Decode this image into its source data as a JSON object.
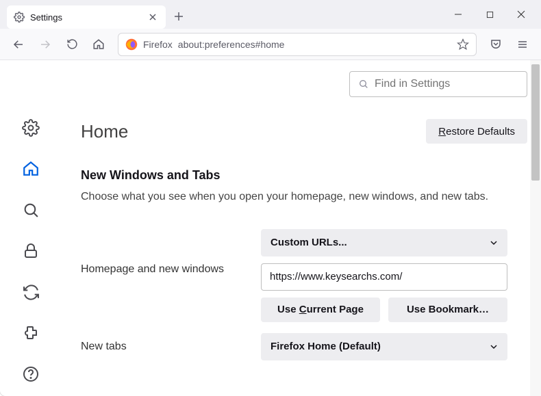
{
  "tab": {
    "title": "Settings"
  },
  "urlbar": {
    "browser_label": "Firefox",
    "url": "about:preferences#home"
  },
  "search": {
    "placeholder": "Find in Settings"
  },
  "page": {
    "title": "Home",
    "restore_btn": "Restore Defaults",
    "section_title": "New Windows and Tabs",
    "section_desc": "Choose what you see when you open your homepage, new windows, and new tabs."
  },
  "homepage": {
    "label": "Homepage and new windows",
    "select_value": "Custom URLs...",
    "url_value": "https://www.keysearchs.com/",
    "use_current": "Use Current Page",
    "use_bookmark": "Use Bookmark…"
  },
  "newtabs": {
    "label": "New tabs",
    "select_value": "Firefox Home (Default)"
  }
}
